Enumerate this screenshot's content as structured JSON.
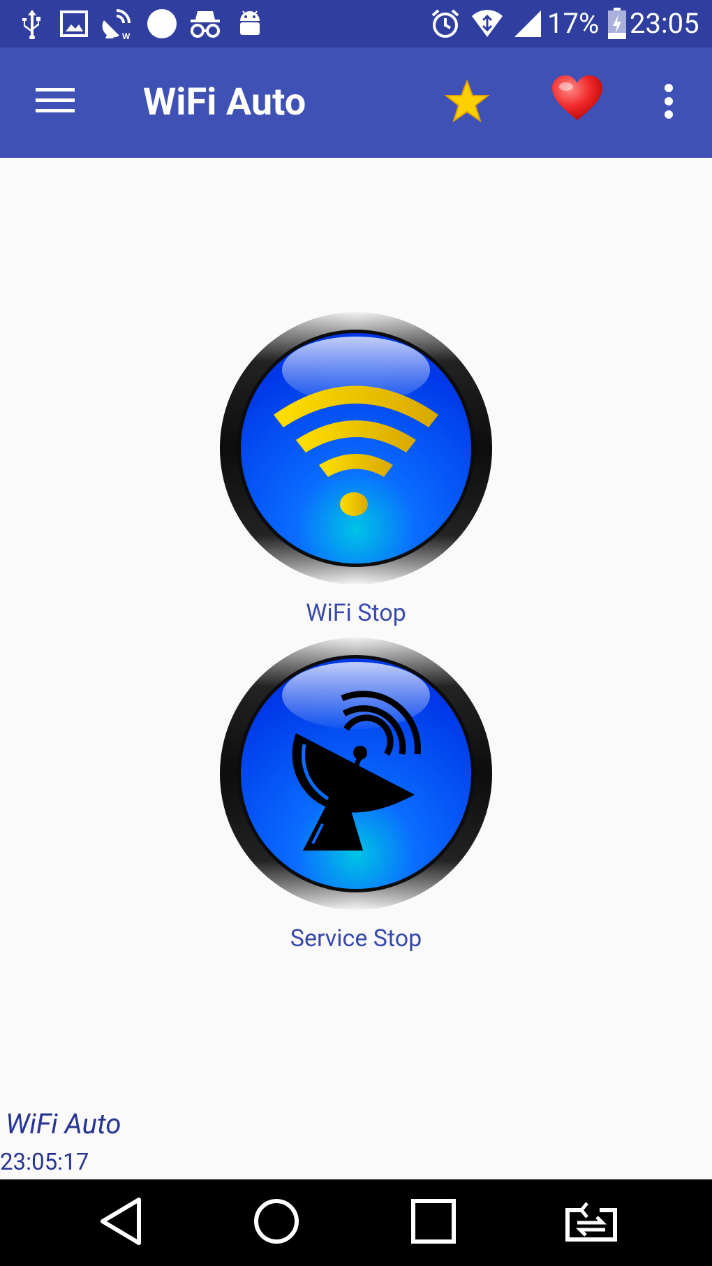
{
  "status_bar": {
    "battery_percent": "17%",
    "time": "23:05",
    "icons": [
      "usb-icon",
      "image-icon",
      "satellite-wifi-icon",
      "circle-icon",
      "incognito-icon",
      "android-icon",
      "alarm-icon",
      "wifi-signal-icon",
      "cell-signal-icon",
      "battery-icon"
    ]
  },
  "app_bar": {
    "title": "WiFi Auto",
    "icons": [
      "menu-icon",
      "star-icon",
      "heart-icon",
      "more-vert-icon"
    ]
  },
  "buttons": {
    "wifi_label": "WiFi Stop",
    "service_label": "Service Stop"
  },
  "footer": {
    "app_name": "WiFi Auto",
    "time": "23:05:17"
  },
  "colors": {
    "status_bar": "#303f9f",
    "app_bar": "#3f51b5",
    "label_text": "#3949ab",
    "button_blue": "#0a4cff",
    "wifi_yellow": "#e6c400"
  },
  "nav_bar": {
    "icons": [
      "back-icon",
      "home-icon",
      "recents-icon",
      "switch-app-icon"
    ]
  }
}
